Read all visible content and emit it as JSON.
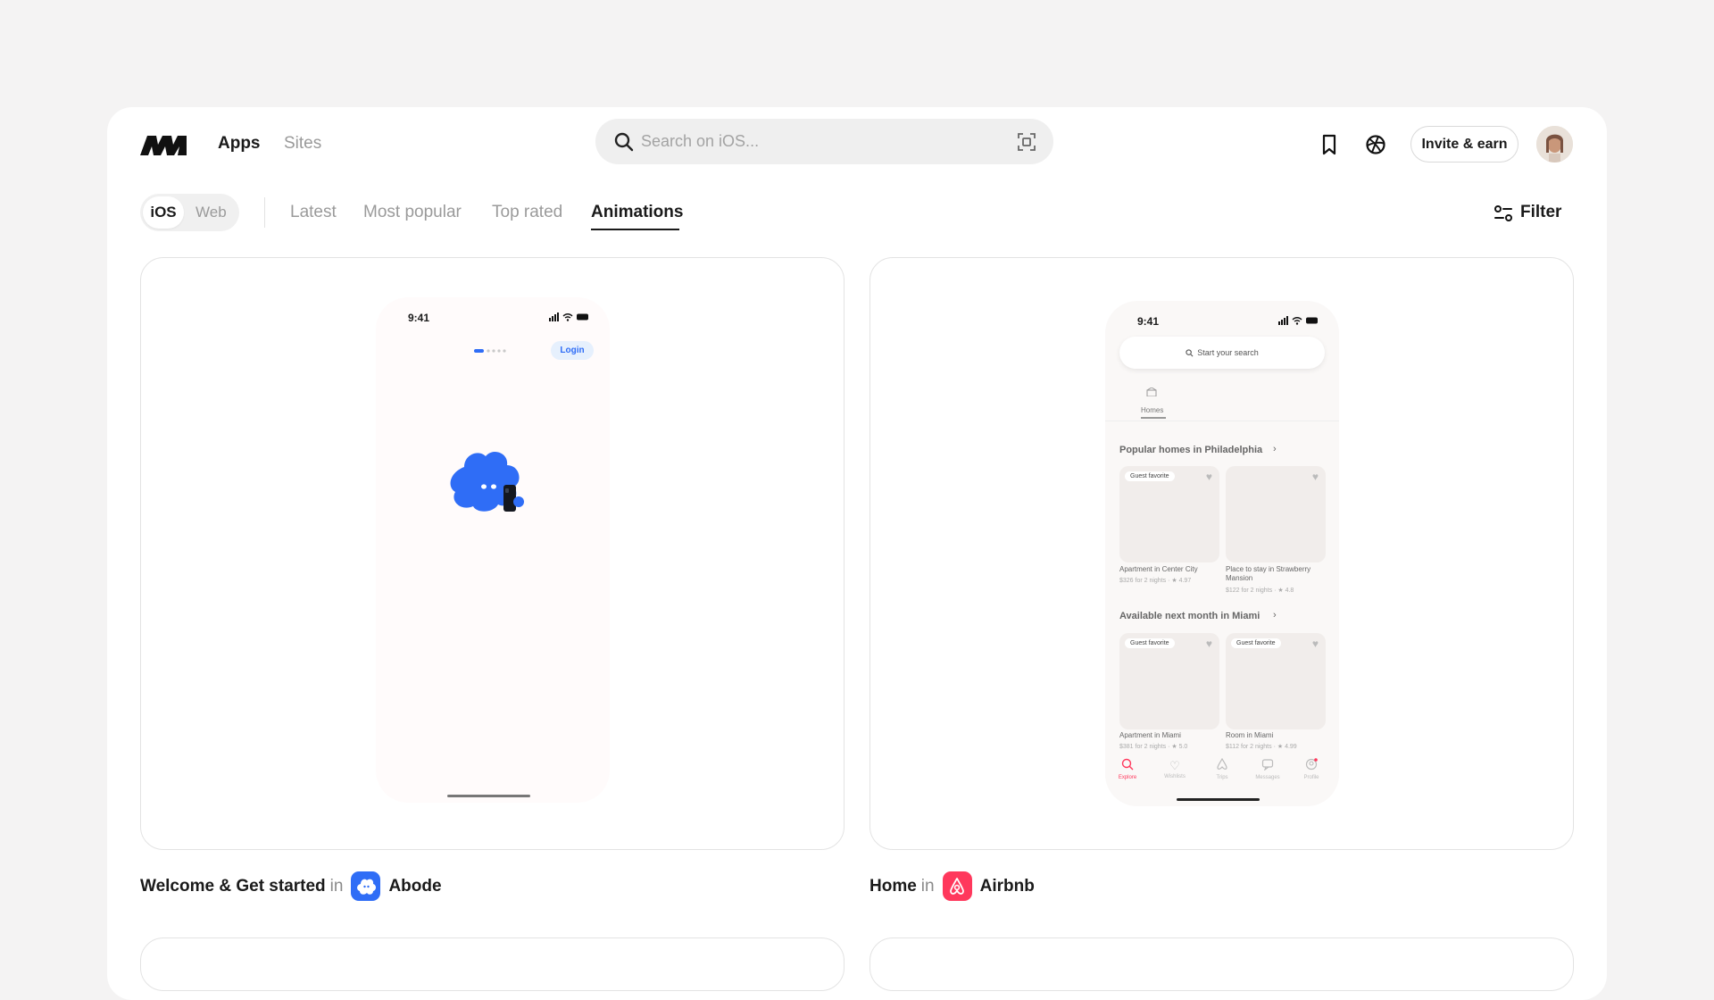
{
  "header": {
    "nav": {
      "apps": "Apps",
      "sites": "Sites"
    },
    "search_placeholder": "Search on iOS...",
    "invite_label": "Invite & earn"
  },
  "subnav": {
    "platforms": {
      "ios": "iOS",
      "web": "Web"
    },
    "tabs": [
      "Latest",
      "Most popular",
      "Top rated",
      "Animations"
    ],
    "active_tab": "Animations",
    "filter_label": "Filter"
  },
  "cards": [
    {
      "title": "Welcome & Get started",
      "in": "in",
      "app": "Abode",
      "app_color": "#2f6df6",
      "phone": {
        "time": "9:41",
        "login_label": "Login"
      }
    },
    {
      "title": "Home",
      "in": "in",
      "app": "Airbnb",
      "app_color": "#ff385c",
      "phone": {
        "time": "9:41",
        "search_label": "Start your search",
        "category": "Homes",
        "section1_title": "Popular homes in Philadelphia",
        "section2_title": "Available next month in Miami",
        "badge": "Guest favorite",
        "listings1": [
          {
            "name": "Apartment in Center City",
            "meta": "$326 for 2 nights · ★ 4.97"
          },
          {
            "name": "Place to stay in Strawberry Mansion",
            "meta": "$122 for 2 nights · ★ 4.8"
          }
        ],
        "listings2": [
          {
            "name": "Apartment in Miami",
            "meta": "$381 for 2 nights · ★ 5.0"
          },
          {
            "name": "Room in Miami",
            "meta": "$112 for 2 nights · ★ 4.99"
          }
        ],
        "tabbar": [
          "Explore",
          "Wishlists",
          "Trips",
          "Messages",
          "Profile"
        ]
      }
    }
  ]
}
